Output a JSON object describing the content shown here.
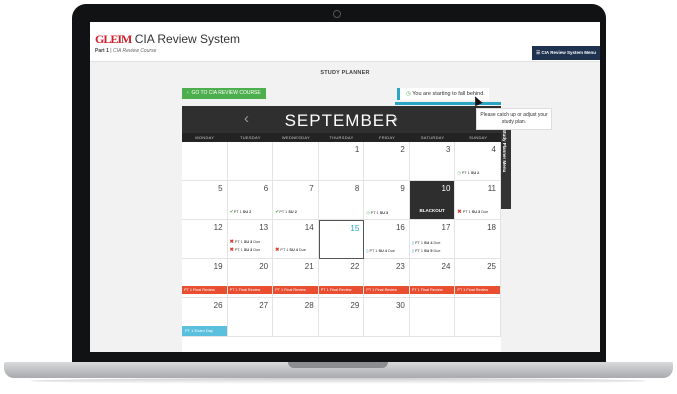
{
  "header": {
    "logo": "GLEIM",
    "title": "CIA Review System",
    "part": "Part 1",
    "course": "CIA Review Course",
    "menu_button": "CIA Review System Menu",
    "menu_icon": "hamburger-icon"
  },
  "planner": {
    "title": "STUDY PLANNER",
    "go_button": "GO TO CIA REVIEW COURSE",
    "go_button_icon": "chevron-left-icon",
    "alert": "You are starting to fall behind.",
    "alert_icon": "clock-icon",
    "tooltip": "Please catch up or adjust your study plan.",
    "side_menu": "Study Planner Menu"
  },
  "calendar": {
    "month": "SEPTEMBER",
    "prev": "‹",
    "next": "›",
    "weekdays": [
      "MONDAY",
      "TUESDAY",
      "WEDNESDAY",
      "THURSDAY",
      "FRIDAY",
      "SATURDAY",
      "SUNDAY"
    ],
    "blackout_label": "BLACKOUT",
    "final_review_label": "PT 1 Final Review",
    "exam_label": "PT 1 Exam Day",
    "days": [
      "",
      "",
      "",
      "1",
      "2",
      "3",
      "4",
      "5",
      "6",
      "7",
      "8",
      "9",
      "10",
      "11",
      "12",
      "13",
      "14",
      "15",
      "16",
      "17",
      "18",
      "19",
      "20",
      "21",
      "22",
      "23",
      "24",
      "25",
      "26",
      "27",
      "28",
      "29",
      "30",
      "",
      ""
    ],
    "events": {
      "d4": {
        "pre": "PT 1 ",
        "su": "SU 2",
        "post": ""
      },
      "d6": {
        "pre": "PT 1 ",
        "su": "SU 2",
        "post": ""
      },
      "d7": {
        "pre": "PT 1 ",
        "su": "SU 2",
        "post": ""
      },
      "d9": {
        "pre": "PT 1 ",
        "su": "SU 3",
        "post": ""
      },
      "d11": {
        "pre": "PT 1 ",
        "su": "SU 3",
        "post": " Due"
      },
      "d13a": {
        "pre": "PT 1 ",
        "su": "SU 3",
        "post": " Due"
      },
      "d13b": {
        "pre": "PT 1 ",
        "su": "SU 3",
        "post": " Due"
      },
      "d14": {
        "pre": "PT 1 ",
        "su": "SU 4",
        "post": " Due"
      },
      "d16": {
        "pre": "PT 1 ",
        "su": "SU 4",
        "post": " Due"
      },
      "d17a": {
        "pre": "PT 1 ",
        "su": "SU 4",
        "post": " Due"
      },
      "d17b": {
        "pre": "PT 1 ",
        "su": "SU 5",
        "post": " Due"
      }
    }
  },
  "colors": {
    "accent": "#2aa6c4",
    "success": "#4cae4c",
    "danger": "#e84e2f",
    "brand_red": "#d21f2b"
  }
}
